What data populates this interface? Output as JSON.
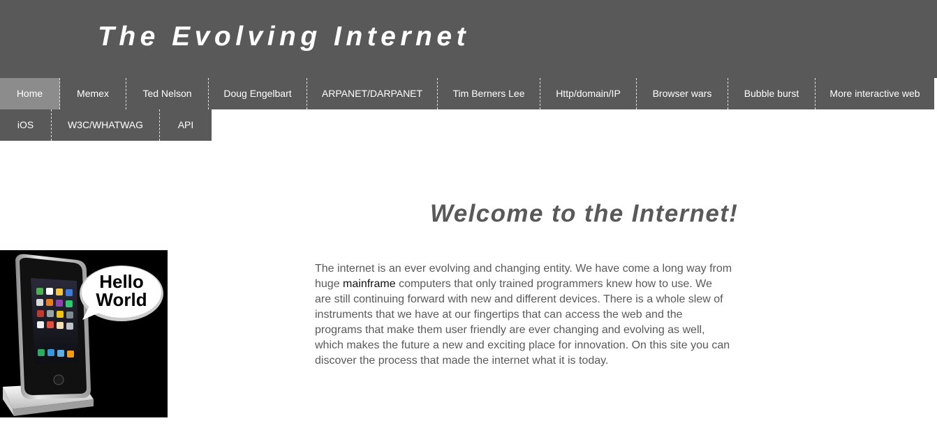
{
  "header": {
    "title": "The Evolving Internet"
  },
  "nav": {
    "row1": [
      {
        "label": "Home",
        "active": true
      },
      {
        "label": "Memex"
      },
      {
        "label": "Ted Nelson"
      },
      {
        "label": "Doug Engelbart"
      },
      {
        "label": "ARPANET/DARPANET"
      },
      {
        "label": "Tim Berners Lee"
      },
      {
        "label": "Http/domain/IP"
      },
      {
        "label": "Browser wars"
      },
      {
        "label": "Bubble burst"
      },
      {
        "label": "More interactive web"
      }
    ],
    "row2": [
      {
        "label": "iOS"
      },
      {
        "label": "W3C/WHATWAG"
      },
      {
        "label": "API"
      }
    ]
  },
  "main": {
    "heading": "Welcome to the Internet!",
    "paragraph": {
      "line1": "The internet is an ever evolving and changing entity. We have come a long way from",
      "line2_before": "huge ",
      "line2_link": "mainframe",
      "line2_after": " computers that only trained programmers knew how to use. We",
      "line3": "are still continuing forward with new and different devices. There is a whole slew of",
      "line4": "instruments that we have at our fingertips that can access the web and the",
      "line5": "programs that make them user friendly are ever changing and evolving as well,",
      "line6": "which makes the future a new and exciting place for innovation. On this site you can",
      "line7": "discover the process that made the internet what it is today."
    },
    "image": {
      "bubble_line1": "Hello",
      "bubble_line2": "World"
    }
  },
  "colors": {
    "header_bg": "#595959",
    "nav_active": "#8c8c8c",
    "text": "#595959"
  }
}
